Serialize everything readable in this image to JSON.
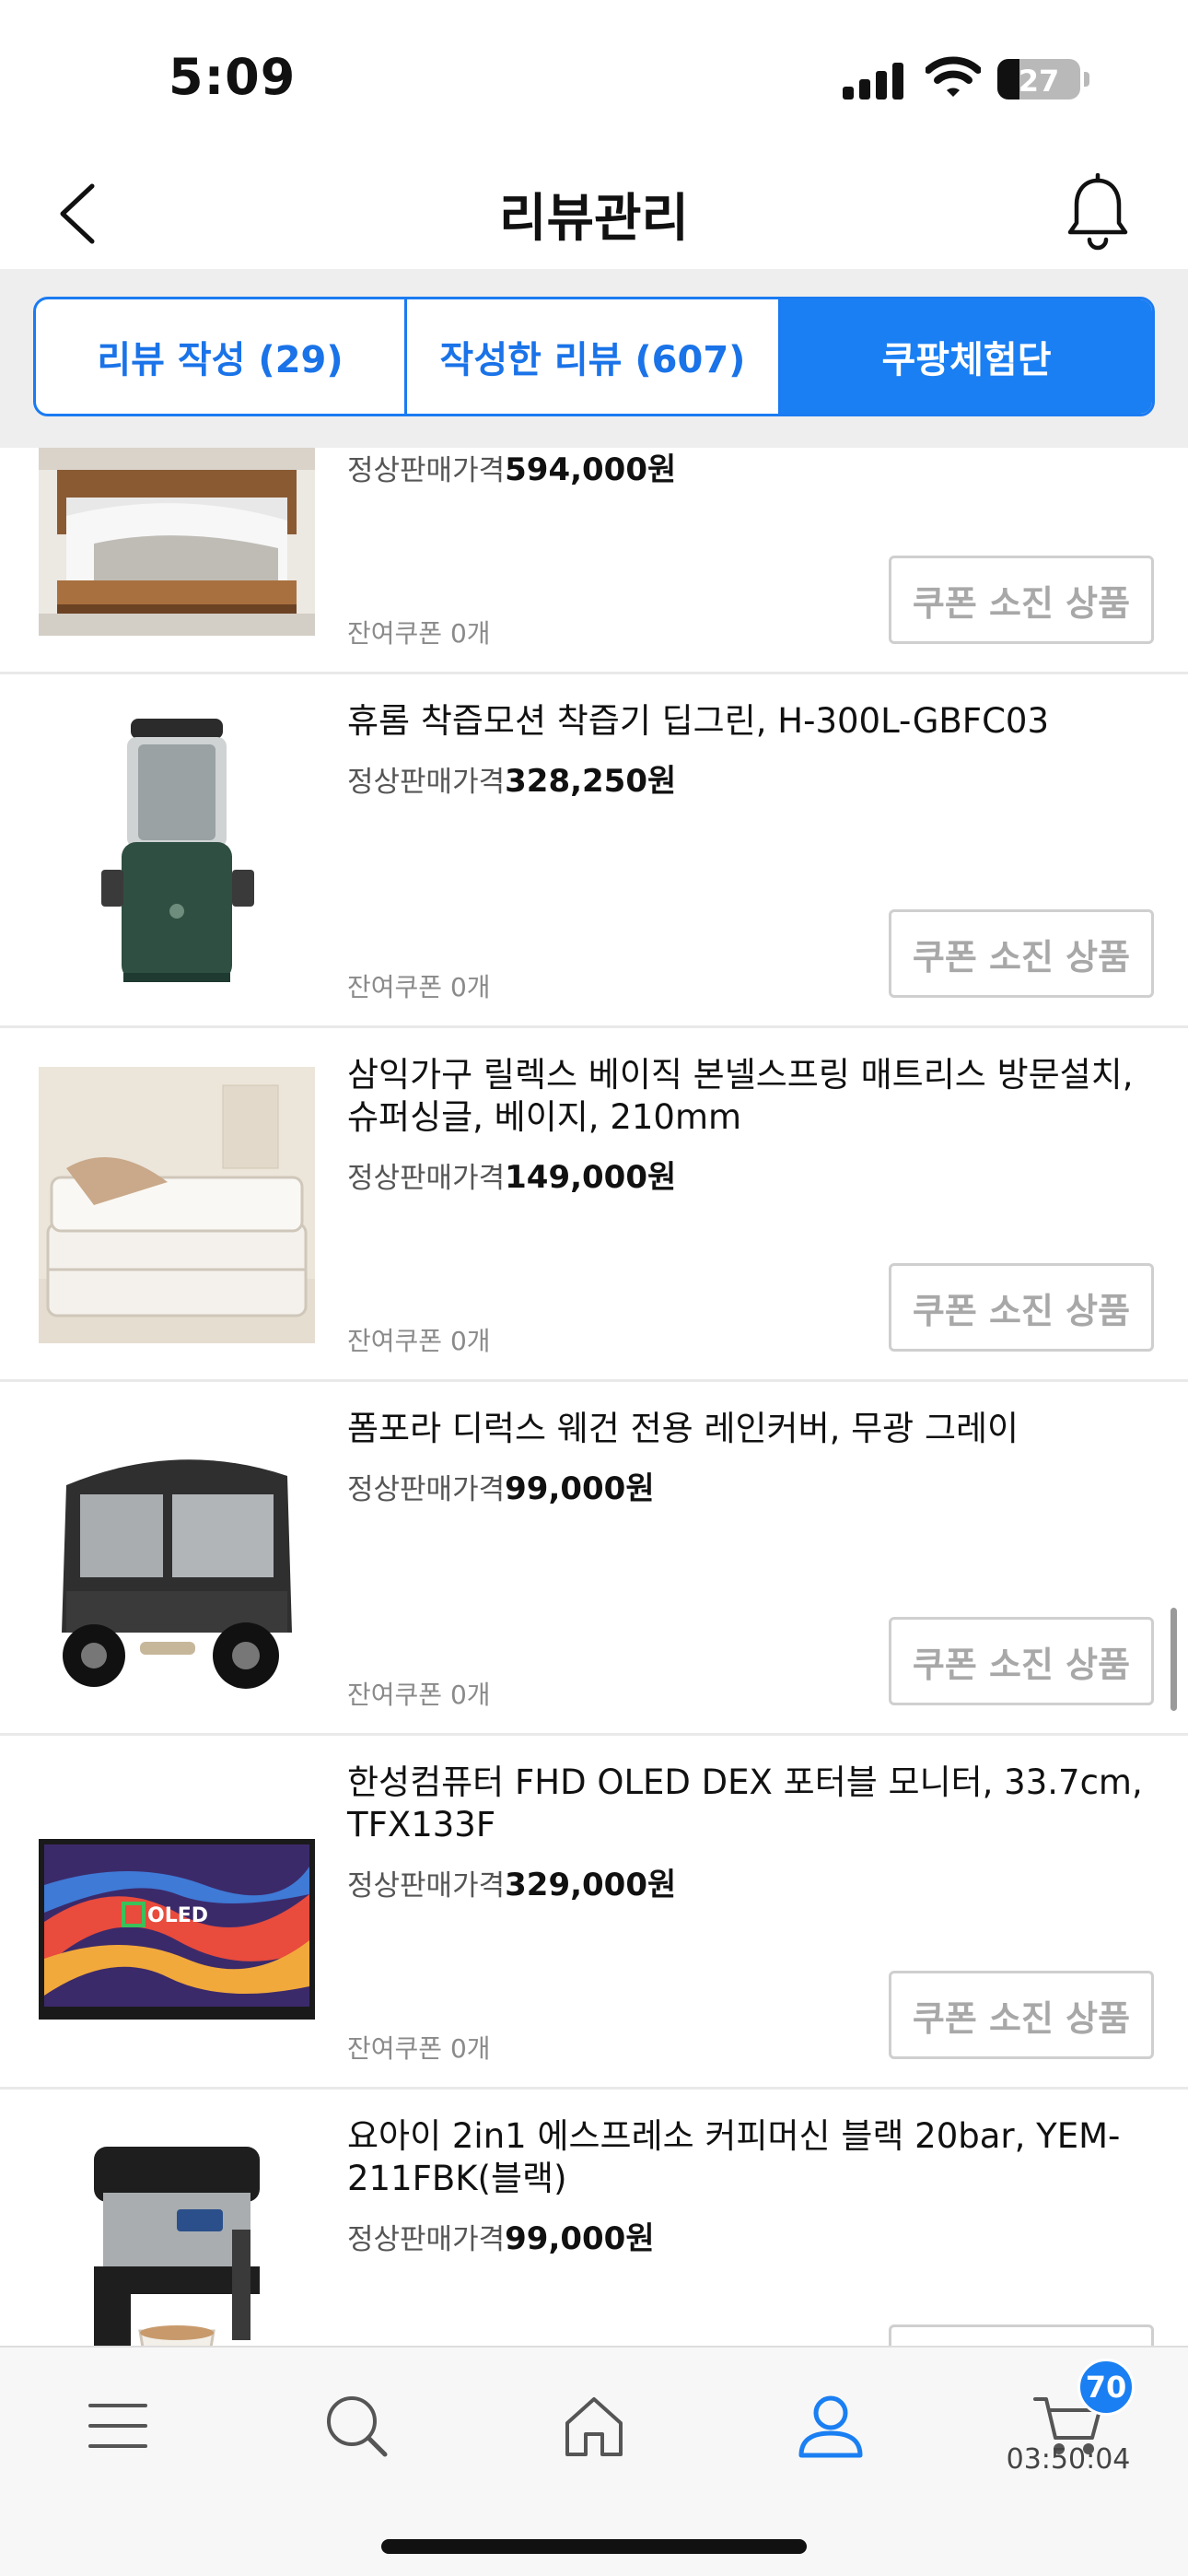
{
  "status_bar": {
    "time": "5:09",
    "battery": "27"
  },
  "header": {
    "title": "리뷰관리"
  },
  "tabs": [
    {
      "label": "리뷰 작성 (29)",
      "active": false
    },
    {
      "label": "작성한 리뷰 (607)",
      "active": false
    },
    {
      "label": "쿠팡체험단",
      "active": true
    }
  ],
  "labels": {
    "price_prefix": "정상판매가격",
    "coupon_remaining": "잔여쿠폰 0개",
    "soldout_button": "쿠폰 소진 상품"
  },
  "products": [
    {
      "name": "",
      "price": "594,000원",
      "image": "bed-frame-image"
    },
    {
      "name": "휴롬 착즙모션 착즙기 딥그린, H-300L-GBFC03",
      "price": "328,250원",
      "image": "juicer-image"
    },
    {
      "name": "삼익가구 릴렉스 베이직 본넬스프링 매트리스 방문설치, 슈퍼싱글, 베이지, 210mm",
      "price": "149,000원",
      "image": "mattress-image"
    },
    {
      "name": "폼포라 디럭스 웨건 전용 레인커버, 무광 그레이",
      "price": "99,000원",
      "image": "wagon-raincover-image"
    },
    {
      "name": "한성컴퓨터 FHD OLED DEX 포터블 모니터, 33.7cm, TFX133F",
      "price": "329,000원",
      "image": "portable-monitor-image",
      "image_text": "OLED"
    },
    {
      "name": "요아이 2in1 에스프레소 커피머신 블랙 20bar, YEM-211FBK(블랙)",
      "price": "99,000원",
      "image": "espresso-machine-image"
    }
  ],
  "bottom_nav": {
    "items": [
      "menu-icon",
      "search-icon",
      "home-icon",
      "account-icon",
      "cart-icon"
    ],
    "cart_badge": "70",
    "cart_timer": "03:50:04"
  },
  "colors": {
    "accent": "#1a7ff2",
    "soldout_border": "#cfcfcf",
    "tab_bg": "#eeeeee"
  }
}
